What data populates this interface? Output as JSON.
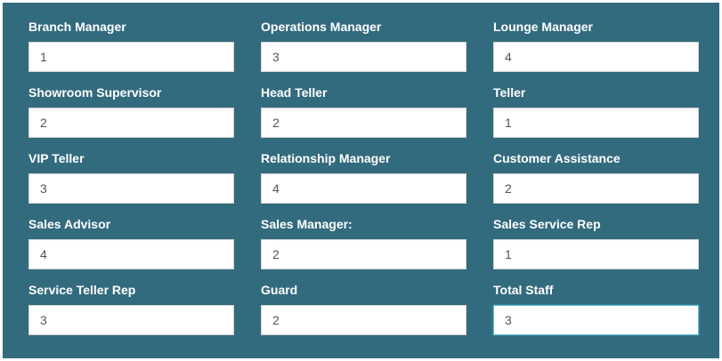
{
  "form": {
    "fields": [
      {
        "label": "Branch Manager",
        "value": "1"
      },
      {
        "label": "Operations Manager",
        "value": "3"
      },
      {
        "label": "Lounge Manager",
        "value": "4"
      },
      {
        "label": "Showroom Supervisor",
        "value": "2"
      },
      {
        "label": "Head Teller",
        "value": "2"
      },
      {
        "label": "Teller",
        "value": "1"
      },
      {
        "label": "VIP Teller",
        "value": "3"
      },
      {
        "label": "Relationship Manager",
        "value": "4"
      },
      {
        "label": "Customer Assistance",
        "value": "2"
      },
      {
        "label": "Sales Advisor",
        "value": "4"
      },
      {
        "label": "Sales Manager:",
        "value": "2"
      },
      {
        "label": "Sales Service Rep",
        "value": "1"
      },
      {
        "label": "Service Teller Rep",
        "value": "3"
      },
      {
        "label": "Guard",
        "value": "2"
      },
      {
        "label": "Total Staff",
        "value": "3"
      }
    ]
  },
  "colors": {
    "panel_background": "#336b7e",
    "label_text": "#ffffff",
    "input_text": "#555555",
    "focus_border": "#5bc0de"
  }
}
